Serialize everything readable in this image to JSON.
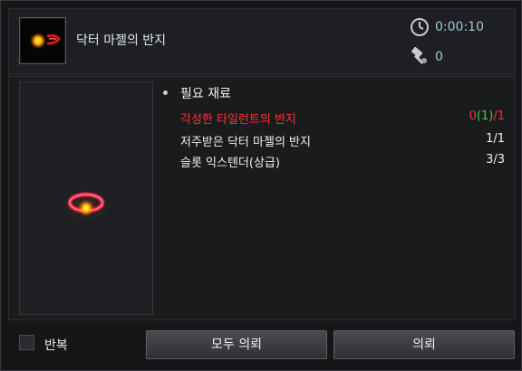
{
  "header": {
    "item_name": "닥터 마젤의 반지",
    "timer_value": "0:00:10",
    "hammer_value": "0",
    "icons": {
      "timer": "clock-icon",
      "hammer": "hammer-icon"
    }
  },
  "materials": {
    "heading": "필요 재료",
    "rows": [
      {
        "name": "각성한 타일런트의 반지",
        "count_a": "0",
        "count_b": "(1)",
        "count_c": "/1",
        "status": "insufficient"
      },
      {
        "name": "저주받은 닥터 마젤의 반지",
        "count": "1/1"
      },
      {
        "name": "슬롯 익스텐더(상급)",
        "count": "3/3"
      }
    ]
  },
  "footer": {
    "repeat_label": "반복",
    "repeat_checked": false,
    "request_all_label": "모두 의뢰",
    "request_label": "의뢰"
  },
  "colors": {
    "insufficient": "#ff3030",
    "owned": "#40d040",
    "accent_text": "#9fc9d6"
  }
}
